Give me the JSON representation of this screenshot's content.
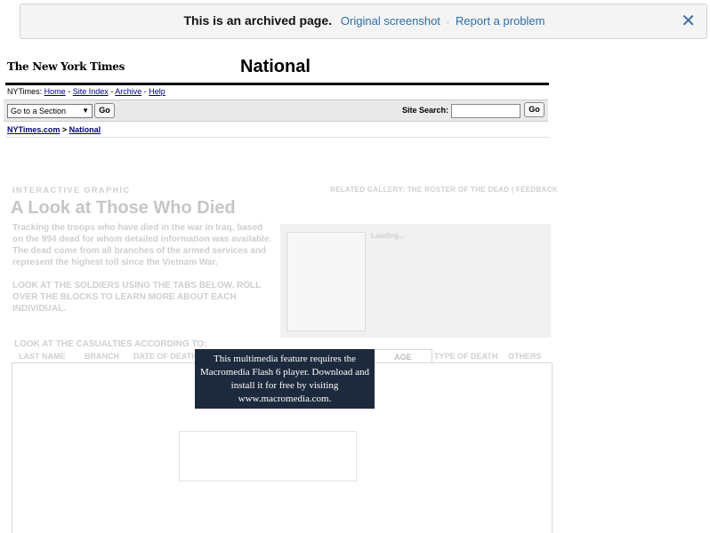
{
  "archive_bar": {
    "message": "This is an archived page.",
    "original_link": "Original screenshot",
    "separator": "·",
    "report_link": "Report a problem",
    "close_glyph": "✕"
  },
  "header": {
    "logo": "The New York Times",
    "section_title": "National"
  },
  "util_nav": {
    "prefix": "NYTimes: ",
    "links": [
      "Home",
      "Site Index",
      "Archive",
      "Help"
    ],
    "separator": " - "
  },
  "search": {
    "section_select_value": "Go to a Section",
    "select_arrow": "▼",
    "go_label": "Go",
    "site_search_label": "Site Search:",
    "site_search_value": "",
    "site_search_go": "Go"
  },
  "breadcrumb": {
    "home": "NYTimes.com",
    "separator": " > ",
    "current": "National"
  },
  "graphic": {
    "kicker": "INTERACTIVE GRAPHIC",
    "related": "RELATED GALLERY:  THE ROSTER OF THE DEAD   |  FEEDBACK",
    "title": "A Look at Those Who Died",
    "description": "Tracking the troops who have died in the war in Iraq, based on the 994 dead for whom detailed information was available. The dead come from all branches of the armed services and represent the highest toll since the Vietnam War.",
    "instructions": "LOOK AT THE SOLDIERS USING THE TABS BELOW. ROLL OVER THE BLOCKS TO LEARN MORE ABOUT EACH INDIVIDUAL.",
    "loading": "Loading...",
    "look_at": "LOOK AT THE CASUALTIES ACCORDING TO:",
    "tabs": {
      "last_name": "LAST NAME",
      "branch": "BRANCH",
      "date_of_death": "DATE OF DEATH",
      "age": "AGE",
      "type_of_death": "TYPE OF DEATH",
      "others": "OTHERS"
    }
  },
  "flash_notice": {
    "text": "This multimedia feature requires the Macromedia Flash 6 player. Download and install it for free by visiting www.macromedia.com."
  }
}
